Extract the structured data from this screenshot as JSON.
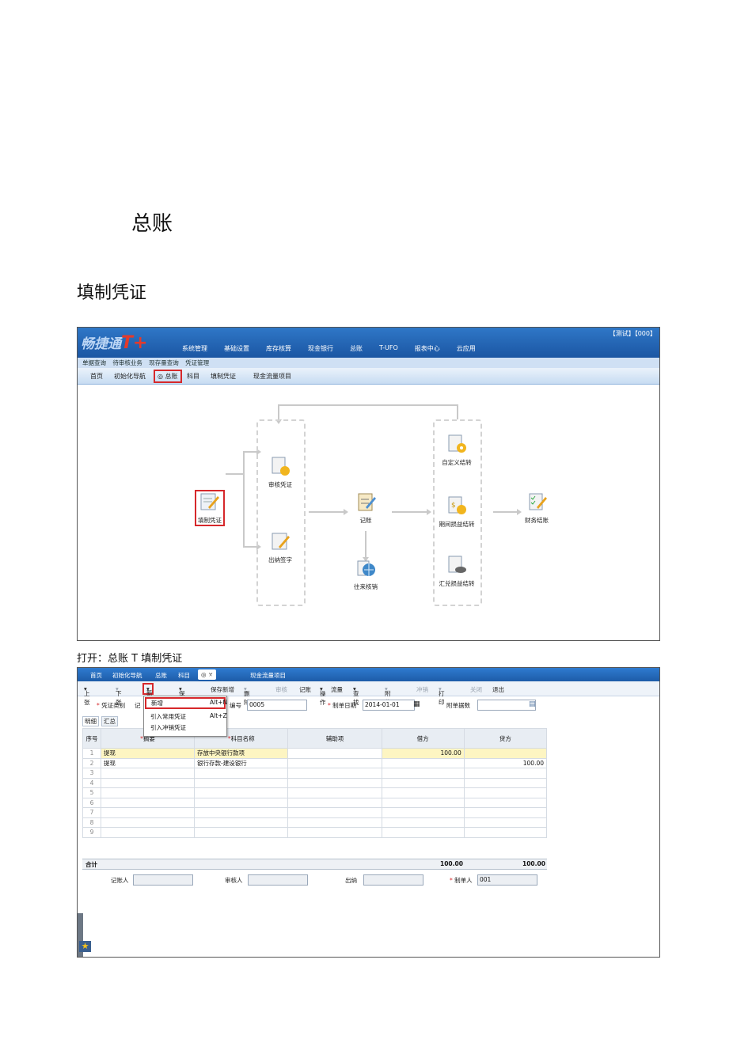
{
  "doc": {
    "heading": "总账",
    "subheading": "填制凭证",
    "caption": "打开：总账 T 填制凭证"
  },
  "shot1": {
    "logo_text": "畅捷通",
    "logo_mark": "T+",
    "top_right": "【测试】【000】",
    "menu": [
      "系统管理",
      "基础设置",
      "库存核算",
      "现金银行",
      "总账",
      "T-UFO",
      "报表中心",
      "云应用"
    ],
    "quickbar": [
      "单据查询",
      "待审核业务",
      "现存量查询",
      "凭证管理"
    ],
    "tabs": [
      "首页",
      "初始化导航",
      "总账",
      "科目",
      "填制凭证",
      "现金流量项目"
    ],
    "flow": {
      "fill": "填制凭证",
      "audit": "审核凭证",
      "cashier": "出纳签字",
      "post": "记账",
      "reconcile": "往来核销",
      "custom_transfer": "自定义结转",
      "period_transfer": "期间损益结转",
      "fx_transfer": "汇兑损益结转",
      "close": "财务结账"
    }
  },
  "shot2": {
    "tabs": [
      "首页",
      "初始化导航",
      "总账",
      "科目",
      "填制凭证",
      "现金流量项目"
    ],
    "toolbar": [
      "上张",
      "下张",
      "新增",
      "保存",
      "保存新增",
      "删除",
      "审核",
      "记账",
      "操作",
      "流量",
      "查找",
      "附件",
      "冲销",
      "打印",
      "关闭",
      "退出"
    ],
    "menu_items": [
      {
        "label": "新增",
        "shortcut": "Alt+N"
      },
      {
        "label": "引入常用凭证",
        "shortcut": "Alt+Z"
      },
      {
        "label": "引入冲销凭证",
        "shortcut": ""
      }
    ],
    "form": {
      "voucher_type_label": "凭证类别",
      "voucher_type_value": "记",
      "number_label": "编号",
      "number_value": "0005",
      "date_label": "制单日期",
      "date_value": "2014-01-01",
      "attach_label": "附单据数",
      "attach_value": ""
    },
    "subtabs": [
      "明细",
      "汇总"
    ],
    "columns": [
      "序号",
      "摘要",
      "科目名称",
      "辅助项",
      "借方",
      "贷方"
    ],
    "rows": [
      {
        "idx": "1",
        "summary": "提现",
        "account": "存放中央银行款项",
        "aux": "",
        "debit": "100.00",
        "credit": ""
      },
      {
        "idx": "2",
        "summary": "提现",
        "account": "银行存款-建设银行",
        "aux": "",
        "debit": "",
        "credit": "100.00"
      },
      {
        "idx": "3",
        "summary": "",
        "account": "",
        "aux": "",
        "debit": "",
        "credit": ""
      },
      {
        "idx": "4",
        "summary": "",
        "account": "",
        "aux": "",
        "debit": "",
        "credit": ""
      },
      {
        "idx": "5",
        "summary": "",
        "account": "",
        "aux": "",
        "debit": "",
        "credit": ""
      },
      {
        "idx": "6",
        "summary": "",
        "account": "",
        "aux": "",
        "debit": "",
        "credit": ""
      },
      {
        "idx": "7",
        "summary": "",
        "account": "",
        "aux": "",
        "debit": "",
        "credit": ""
      },
      {
        "idx": "8",
        "summary": "",
        "account": "",
        "aux": "",
        "debit": "",
        "credit": ""
      },
      {
        "idx": "9",
        "summary": "",
        "account": "",
        "aux": "",
        "debit": "",
        "credit": ""
      }
    ],
    "total_label": "合计",
    "total_debit": "100.00",
    "total_credit": "100.00",
    "footer": {
      "poster_label": "记账人",
      "auditor_label": "审核人",
      "cashier_label": "出纳",
      "maker_label": "制单人",
      "maker_value": "001"
    }
  },
  "colors": {
    "accent": "#1f5fae",
    "highlight": "#d6282b"
  }
}
